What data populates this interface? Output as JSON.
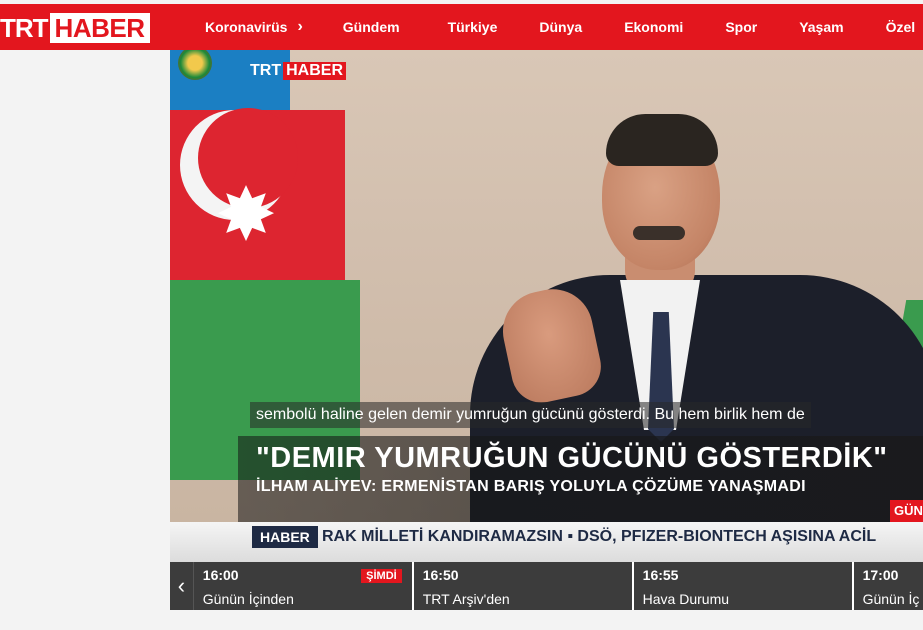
{
  "header": {
    "logo_trt": "TRT",
    "logo_haber": "HABER",
    "nav": [
      {
        "label": "Koronavirüs"
      },
      {
        "label": "Gündem"
      },
      {
        "label": "Türkiye"
      },
      {
        "label": "Dünya"
      },
      {
        "label": "Ekonomi"
      },
      {
        "label": "Spor"
      },
      {
        "label": "Yaşam"
      },
      {
        "label": "Özel"
      }
    ],
    "nav_chevron": "›"
  },
  "video": {
    "watermark_trt": "TRT",
    "watermark_haber": "HABER",
    "subtitle": "sembolü haline gelen demir yumruğun gücünü gösterdi. Bu hem birlik hem de",
    "headline": "\"DEMIR YUMRUĞUN GÜCÜNÜ GÖSTERDİK\"",
    "subheadline": "İLHAM ALİYEV: ERMENİSTAN BARIŞ YOLUYLA ÇÖZÜME YANAŞMADI",
    "corner_tag": "GÜN"
  },
  "ticker": {
    "brand": "HABER",
    "text": "RAK MİLLETİ KANDIRAMAZSIN   ▪ DSÖ, PFIZER-BIONTECH AŞISINA ACİL"
  },
  "schedule": {
    "prev_icon": "‹",
    "items": [
      {
        "time": "16:00",
        "title": "Günün İçinden",
        "badge": "ŞİMDİ"
      },
      {
        "time": "16:50",
        "title": "TRT Arşiv'den"
      },
      {
        "time": "16:55",
        "title": "Hava Durumu"
      },
      {
        "time": "17:00",
        "title": "Günün İç"
      }
    ]
  },
  "colors": {
    "brand_red": "#e3161e",
    "ticker_navy": "#1e2a44",
    "schedule_bg": "#3c3c3c"
  }
}
